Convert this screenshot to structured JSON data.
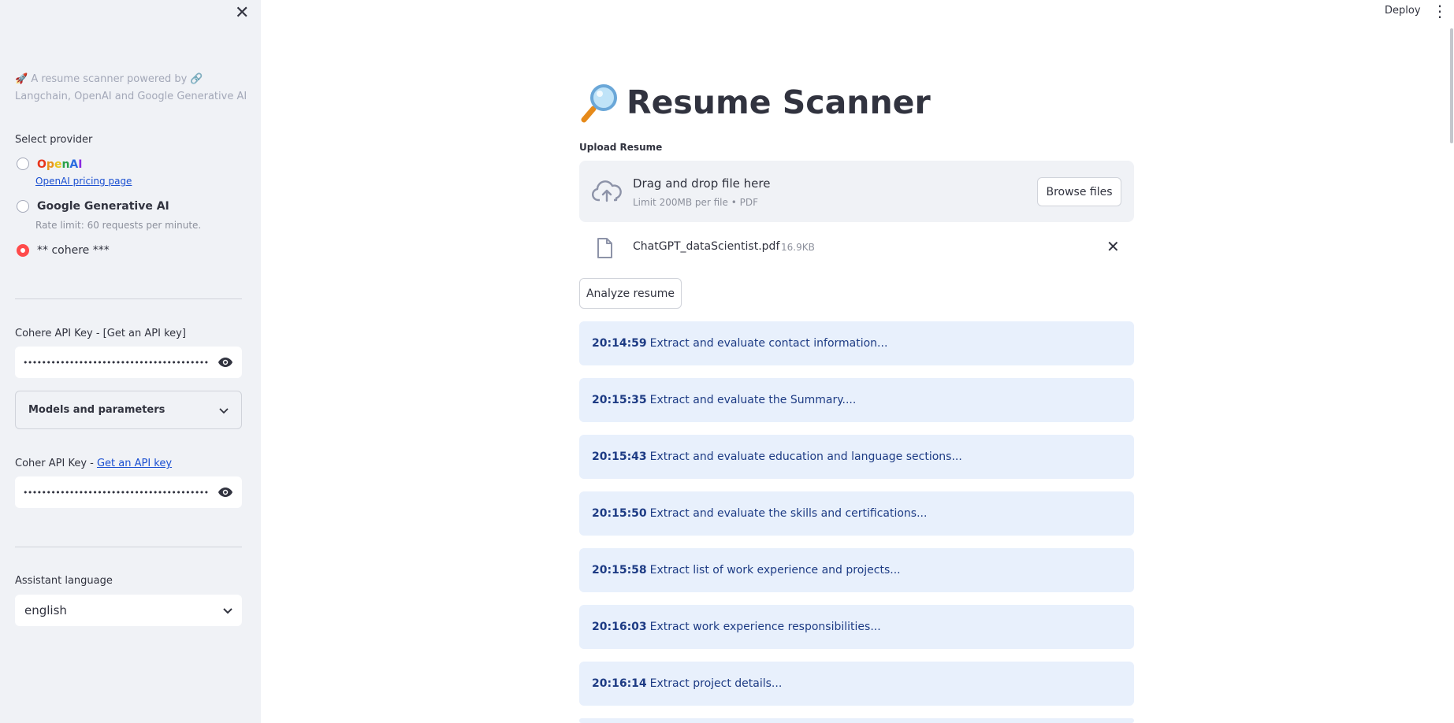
{
  "app": {
    "title": "Resume Scanner",
    "deploy_label": "Deploy"
  },
  "sidebar": {
    "tagline": "🚀 A resume scanner powered by 🔗 Langchain, OpenAI and Google Generative AI",
    "provider_label": "Select provider",
    "providers": [
      {
        "label": "OpenAI",
        "sub": "OpenAI pricing page",
        "selected": false
      },
      {
        "label": "Google Generative AI",
        "sub": "Rate limit: 60 requests per minute.",
        "selected": false
      },
      {
        "label": "** cohere ***",
        "selected": true
      }
    ],
    "cohere_key_label": "Cohere API Key - [Get an API key]",
    "cohere_key_value": "••••••••••••••••••••••••••••••••••••••••",
    "models_expander": "Models and parameters",
    "coher_key_label_prefix": "Coher API Key - ",
    "coher_key_link": "Get an API key",
    "coher_key_value": "••••••••••••••••••••••••••••••••••••••••",
    "language_label": "Assistant language",
    "language_value": "english"
  },
  "upload": {
    "label": "Upload Resume",
    "drop_title": "Drag and drop file here",
    "drop_sub": "Limit 200MB per file • PDF",
    "browse_label": "Browse files",
    "file_name": "ChatGPT_dataScientist.pdf",
    "file_size": "16.9KB"
  },
  "analyze_label": "Analyze resume",
  "status_log": [
    {
      "time": "20:14:59",
      "text": "Extract and evaluate contact information..."
    },
    {
      "time": "20:15:35",
      "text": "Extract and evaluate the Summary...."
    },
    {
      "time": "20:15:43",
      "text": "Extract and evaluate education and language sections..."
    },
    {
      "time": "20:15:50",
      "text": "Extract and evaluate the skills and certifications..."
    },
    {
      "time": "20:15:58",
      "text": "Extract list of work experience and projects..."
    },
    {
      "time": "20:16:03",
      "text": "Extract work experience responsibilities..."
    },
    {
      "time": "20:16:14",
      "text": "Extract project details..."
    }
  ],
  "colors": {
    "accent": "#ff4b4b",
    "sidebar_bg": "#f0f2f6",
    "status_bg": "#e8f0fc",
    "status_text": "#1d3b84",
    "link": "#1a4fd1"
  }
}
